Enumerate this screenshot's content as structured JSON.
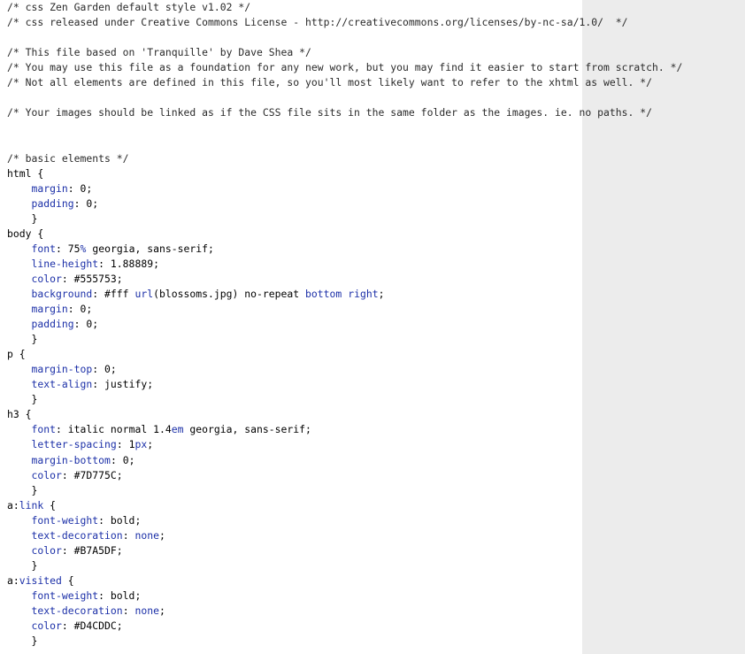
{
  "colors": {
    "background": "#ffffff",
    "gutter": "#ececec",
    "text": "#1a1a1a",
    "property": "#1c30a8",
    "keyword": "#1c30a8"
  },
  "lines": [
    [
      {
        "t": "/* css Zen Garden default style v1.02 */",
        "c": "comment"
      }
    ],
    [
      {
        "t": "/* css released under Creative Commons License - http://creativecommons.org/licenses/by-nc-sa/1.0/  */",
        "c": "comment"
      }
    ],
    [],
    [
      {
        "t": "/* This file based on 'Tranquille' by Dave Shea */",
        "c": "comment"
      }
    ],
    [
      {
        "t": "/* You may use this file as a foundation for any new work, but you may find it easier to start from scratch. */",
        "c": "comment"
      }
    ],
    [
      {
        "t": "/* Not all elements are defined in this file, so you'll most likely want to refer to the xhtml as well. */",
        "c": "comment"
      }
    ],
    [],
    [
      {
        "t": "/* Your images should be linked as if the CSS file sits in the same folder as the images. ie. no paths. */",
        "c": "comment"
      }
    ],
    [],
    [],
    [
      {
        "t": "/* basic elements */",
        "c": "comment"
      }
    ],
    [
      {
        "t": "html {",
        "c": "selector"
      }
    ],
    [
      {
        "t": "    ",
        "c": "punct"
      },
      {
        "t": "margin",
        "c": "prop"
      },
      {
        "t": ": 0;",
        "c": "value"
      }
    ],
    [
      {
        "t": "    ",
        "c": "punct"
      },
      {
        "t": "padding",
        "c": "prop"
      },
      {
        "t": ": 0;",
        "c": "value"
      }
    ],
    [
      {
        "t": "    }",
        "c": "punct"
      }
    ],
    [
      {
        "t": "body {",
        "c": "selector"
      }
    ],
    [
      {
        "t": "    ",
        "c": "punct"
      },
      {
        "t": "font",
        "c": "prop"
      },
      {
        "t": ": 75",
        "c": "value"
      },
      {
        "t": "%",
        "c": "unit"
      },
      {
        "t": " georgia, sans-serif;",
        "c": "value"
      }
    ],
    [
      {
        "t": "    ",
        "c": "punct"
      },
      {
        "t": "line-height",
        "c": "prop"
      },
      {
        "t": ": 1.88889;",
        "c": "value"
      }
    ],
    [
      {
        "t": "    ",
        "c": "punct"
      },
      {
        "t": "color",
        "c": "prop"
      },
      {
        "t": ": #555753;",
        "c": "value"
      }
    ],
    [
      {
        "t": "    ",
        "c": "punct"
      },
      {
        "t": "background",
        "c": "prop"
      },
      {
        "t": ": #fff ",
        "c": "value"
      },
      {
        "t": "url",
        "c": "func"
      },
      {
        "t": "(blossoms.jpg) no-repeat ",
        "c": "value"
      },
      {
        "t": "bottom",
        "c": "keyword"
      },
      {
        "t": " ",
        "c": "value"
      },
      {
        "t": "right",
        "c": "keyword"
      },
      {
        "t": ";",
        "c": "value"
      }
    ],
    [
      {
        "t": "    ",
        "c": "punct"
      },
      {
        "t": "margin",
        "c": "prop"
      },
      {
        "t": ": 0;",
        "c": "value"
      }
    ],
    [
      {
        "t": "    ",
        "c": "punct"
      },
      {
        "t": "padding",
        "c": "prop"
      },
      {
        "t": ": 0;",
        "c": "value"
      }
    ],
    [
      {
        "t": "    }",
        "c": "punct"
      }
    ],
    [
      {
        "t": "p {",
        "c": "selector"
      }
    ],
    [
      {
        "t": "    ",
        "c": "punct"
      },
      {
        "t": "margin-top",
        "c": "prop"
      },
      {
        "t": ": 0;",
        "c": "value"
      }
    ],
    [
      {
        "t": "    ",
        "c": "punct"
      },
      {
        "t": "text-align",
        "c": "prop"
      },
      {
        "t": ": justify;",
        "c": "value"
      }
    ],
    [
      {
        "t": "    }",
        "c": "punct"
      }
    ],
    [
      {
        "t": "h3 {",
        "c": "selector"
      }
    ],
    [
      {
        "t": "    ",
        "c": "punct"
      },
      {
        "t": "font",
        "c": "prop"
      },
      {
        "t": ": italic normal 1.4",
        "c": "value"
      },
      {
        "t": "em",
        "c": "unit"
      },
      {
        "t": " georgia, sans-serif;",
        "c": "value"
      }
    ],
    [
      {
        "t": "    ",
        "c": "punct"
      },
      {
        "t": "letter-spacing",
        "c": "prop"
      },
      {
        "t": ": 1",
        "c": "value"
      },
      {
        "t": "px",
        "c": "unit"
      },
      {
        "t": ";",
        "c": "value"
      }
    ],
    [
      {
        "t": "    ",
        "c": "punct"
      },
      {
        "t": "margin-bottom",
        "c": "prop"
      },
      {
        "t": ": 0;",
        "c": "value"
      }
    ],
    [
      {
        "t": "    ",
        "c": "punct"
      },
      {
        "t": "color",
        "c": "prop"
      },
      {
        "t": ": #7D775C;",
        "c": "value"
      }
    ],
    [
      {
        "t": "    }",
        "c": "punct"
      }
    ],
    [
      {
        "t": "a:",
        "c": "selector"
      },
      {
        "t": "link",
        "c": "keyword"
      },
      {
        "t": " {",
        "c": "selector"
      }
    ],
    [
      {
        "t": "    ",
        "c": "punct"
      },
      {
        "t": "font-weight",
        "c": "prop"
      },
      {
        "t": ": bold;",
        "c": "value"
      }
    ],
    [
      {
        "t": "    ",
        "c": "punct"
      },
      {
        "t": "text-decoration",
        "c": "prop"
      },
      {
        "t": ": ",
        "c": "value"
      },
      {
        "t": "none",
        "c": "keyword"
      },
      {
        "t": ";",
        "c": "value"
      }
    ],
    [
      {
        "t": "    ",
        "c": "punct"
      },
      {
        "t": "color",
        "c": "prop"
      },
      {
        "t": ": #B7A5DF;",
        "c": "value"
      }
    ],
    [
      {
        "t": "    }",
        "c": "punct"
      }
    ],
    [
      {
        "t": "a:",
        "c": "selector"
      },
      {
        "t": "visited",
        "c": "keyword"
      },
      {
        "t": " {",
        "c": "selector"
      }
    ],
    [
      {
        "t": "    ",
        "c": "punct"
      },
      {
        "t": "font-weight",
        "c": "prop"
      },
      {
        "t": ": bold;",
        "c": "value"
      }
    ],
    [
      {
        "t": "    ",
        "c": "punct"
      },
      {
        "t": "text-decoration",
        "c": "prop"
      },
      {
        "t": ": ",
        "c": "value"
      },
      {
        "t": "none",
        "c": "keyword"
      },
      {
        "t": ";",
        "c": "value"
      }
    ],
    [
      {
        "t": "    ",
        "c": "punct"
      },
      {
        "t": "color",
        "c": "prop"
      },
      {
        "t": ": #D4CDDC;",
        "c": "value"
      }
    ],
    [
      {
        "t": "    }",
        "c": "punct"
      }
    ]
  ]
}
